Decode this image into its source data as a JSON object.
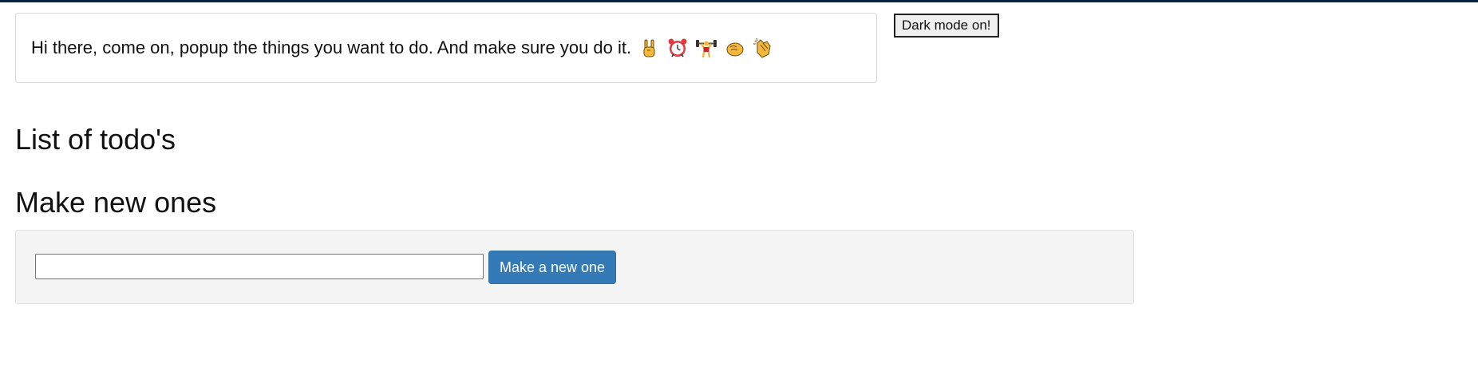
{
  "greeting": {
    "text": "Hi there, come on, popup the things you want to do. And make sure you do it.",
    "emojis": [
      "rock-on-hand",
      "alarm-clock",
      "weightlifter",
      "fist-bump",
      "clapping-hands"
    ]
  },
  "dark_mode": {
    "label": "Dark mode on!"
  },
  "headings": {
    "list": "List of todo's",
    "make": "Make new ones"
  },
  "form": {
    "input_value": "",
    "input_placeholder": "",
    "button_label": "Make a new one"
  },
  "colors": {
    "top_border": "#0b2340",
    "primary_button": "#337ab7",
    "form_background": "#f4f4f4"
  }
}
